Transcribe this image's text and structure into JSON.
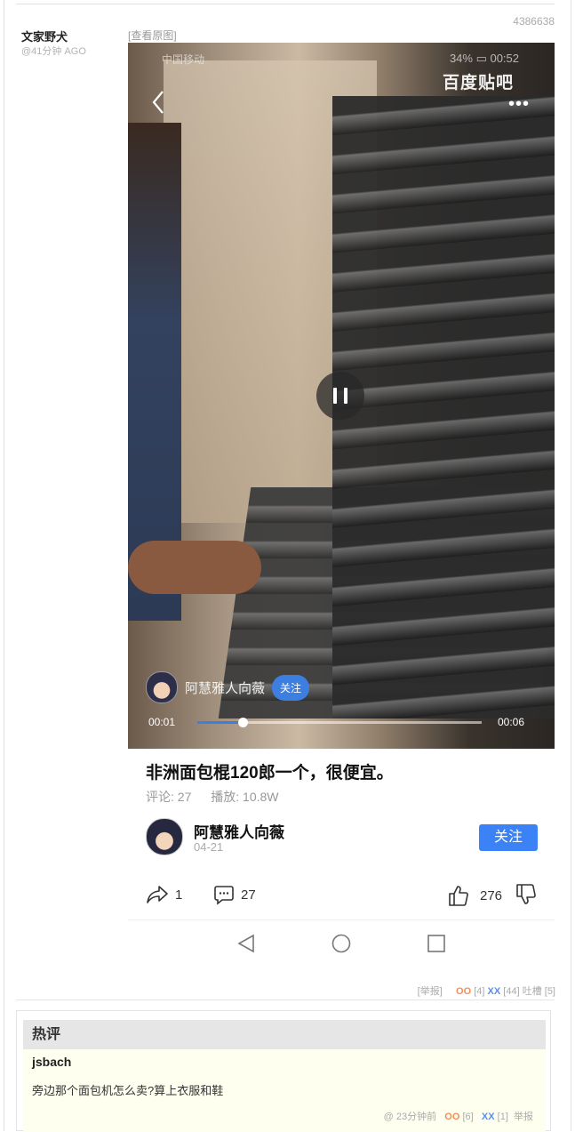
{
  "post": {
    "id": "4386638",
    "author": "文家野犬",
    "time": "@41分钟 AGO",
    "view_original": "[查看原图]"
  },
  "video": {
    "carrier": "中国移动",
    "status": "34% ▭ 00:52",
    "brand": "百度贴吧",
    "more": "•••",
    "uploader_chip": "阿慧雅人向薇",
    "chip_follow": "关注",
    "current_time": "00:01",
    "total_time": "00:06",
    "progress": 0.16
  },
  "detail": {
    "title": "非洲面包棍120郎一个，很便宜。",
    "comments": "评论: 27",
    "plays": "播放: 10.8W",
    "uploader": "阿慧雅人向薇",
    "date": "04-21",
    "follow": "关注",
    "share_count": "1",
    "comment_count": "27",
    "like_count": "276"
  },
  "meta": {
    "report": "[举报]",
    "oo": "OO",
    "oo_count": "[4]",
    "xx": "XX",
    "xx_count": "[44]",
    "tucao": "吐槽 [5]"
  },
  "hot": {
    "heading": "热评",
    "comment": {
      "author": "jsbach",
      "text": "旁边那个面包机怎么卖?算上衣服和鞋",
      "time": "@ 23分钟前",
      "oo": "OO",
      "oo_count": "[6]",
      "xx": "XX",
      "xx_count": "[1]",
      "report": "举报"
    }
  },
  "colors": {
    "accent": "#3b82f6",
    "oo": "#f28f59",
    "xx": "#5b8def"
  }
}
